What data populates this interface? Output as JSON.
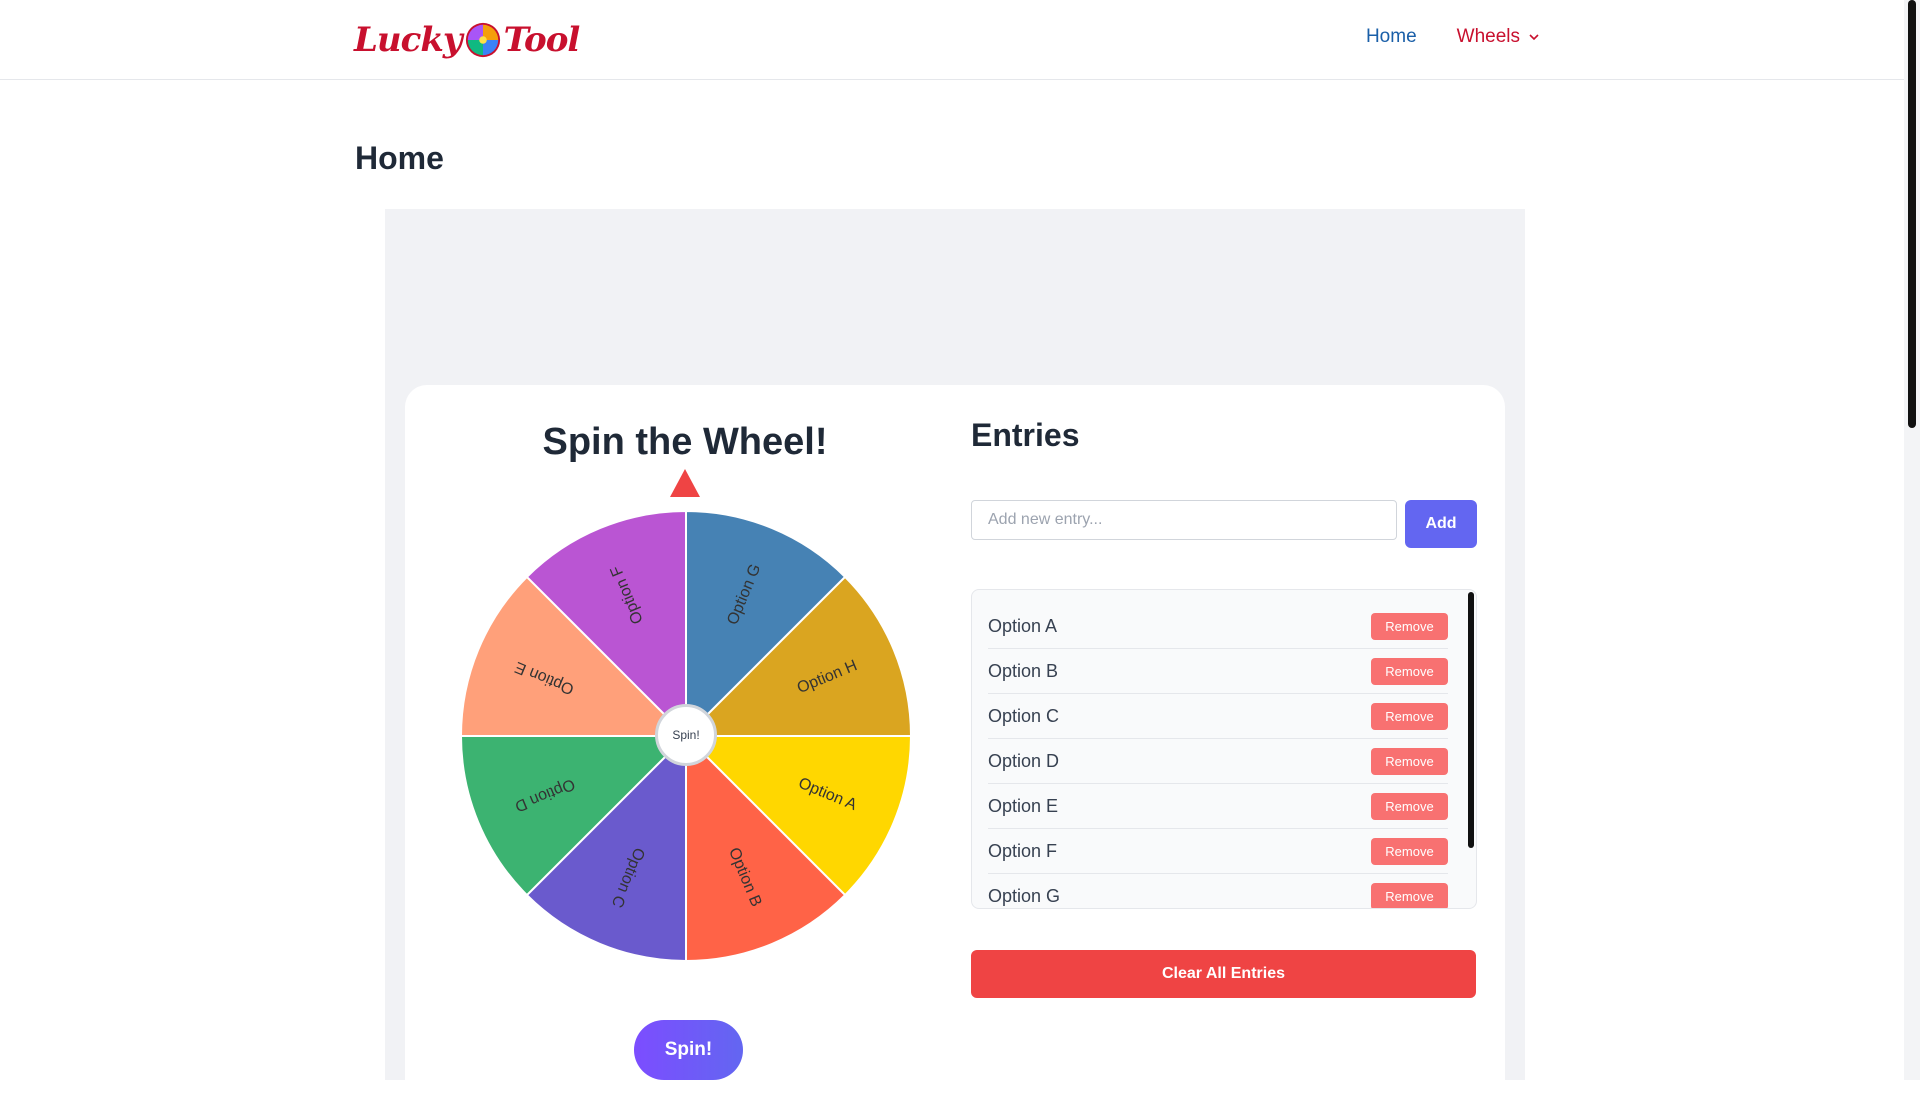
{
  "header": {
    "logo_left": "Lucky",
    "logo_right": "Tool",
    "nav": {
      "home": "Home",
      "wheels": "Wheels"
    }
  },
  "page": {
    "title": "Home"
  },
  "wheel": {
    "title": "Spin the Wheel!",
    "center_label": "Spin!",
    "spin_button": "Spin!",
    "pointer_color": "#ef4444",
    "segments": [
      {
        "label": "Option A",
        "color": "#FFD700"
      },
      {
        "label": "Option B",
        "color": "#FF6347"
      },
      {
        "label": "Option C",
        "color": "#6A5ACD"
      },
      {
        "label": "Option D",
        "color": "#3CB371"
      },
      {
        "label": "Option E",
        "color": "#FFA07A"
      },
      {
        "label": "Option F",
        "color": "#BA55D3"
      },
      {
        "label": "Option G",
        "color": "#4682B4"
      },
      {
        "label": "Option H",
        "color": "#DAA520"
      }
    ]
  },
  "entries": {
    "title": "Entries",
    "input_placeholder": "Add new entry...",
    "add_button": "Add",
    "remove_label": "Remove",
    "items": [
      "Option A",
      "Option B",
      "Option C",
      "Option D",
      "Option E",
      "Option F",
      "Option G"
    ],
    "clear_button": "Clear All Entries"
  },
  "colors": {
    "brand_red": "#c8102e",
    "accent_indigo": "#6366f1",
    "danger": "#ef4444"
  }
}
